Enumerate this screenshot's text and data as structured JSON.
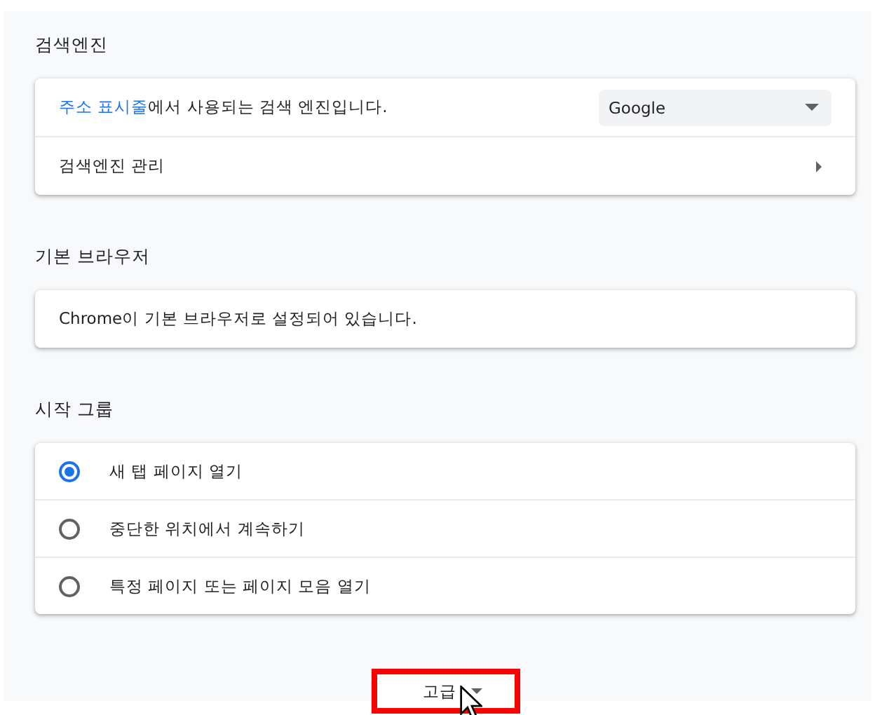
{
  "sections": [
    {
      "title": "검색엔진",
      "rows": [
        {
          "kind": "select",
          "link": "주소 표시줄",
          "text": "에서 사용되는 검색 엔진입니다.",
          "value": "Google"
        },
        {
          "kind": "nav",
          "text": "검색엔진 관리"
        }
      ]
    },
    {
      "title": "기본 브라우저",
      "rows": [
        {
          "kind": "plain",
          "text": "Chrome이 기본 브라우저로 설정되어 있습니다."
        }
      ]
    },
    {
      "title": "시작 그룹",
      "rows": [
        {
          "kind": "radio",
          "text": "새 탭 페이지 열기",
          "selected": true
        },
        {
          "kind": "radio",
          "text": "중단한 위치에서 계속하기",
          "selected": false
        },
        {
          "kind": "radio",
          "text": "특정 페이지 또는 페이지 모음 열기",
          "selected": false
        }
      ]
    }
  ],
  "advanced": {
    "label": "고급",
    "highlighted": true
  }
}
